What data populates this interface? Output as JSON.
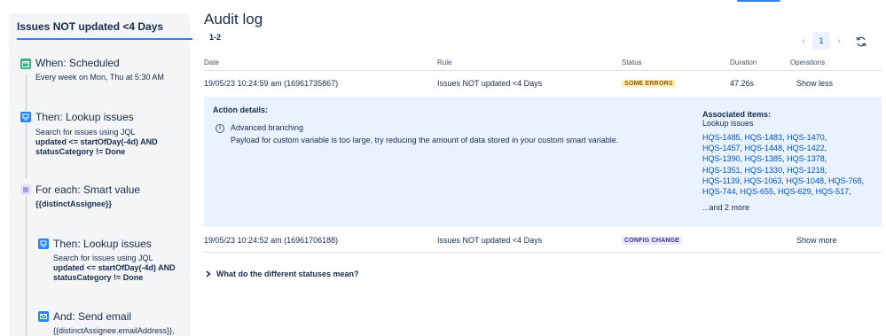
{
  "rule": {
    "title": "Issues NOT updated <4 Days",
    "steps": [
      {
        "heading": "When: Scheduled",
        "lines": [
          "Every week on Mon, Thu at 5:30 AM"
        ]
      },
      {
        "heading": "Then: Lookup issues",
        "lines": [
          "Search for issues using JQL"
        ],
        "bold_lines": [
          "updated <= startOfDay(-4d) AND",
          "statusCategory != Done"
        ]
      },
      {
        "heading": "For each: Smart value",
        "bold_lines": [
          "{{distinctAssignee}}"
        ]
      },
      {
        "heading": "Then: Lookup issues",
        "lines": [
          "Search for issues using JQL"
        ],
        "bold_lines": [
          "updated <= startOfDay(-4d) AND",
          "statusCategory != Done"
        ]
      },
      {
        "heading": "And: Send email",
        "lines": [
          "{{distinctAssignee.emailAddress}},"
        ]
      }
    ]
  },
  "audit": {
    "title": "Audit log",
    "range": "1-2",
    "pagination": {
      "prev": "‹",
      "current": "1",
      "next": "›"
    },
    "columns": {
      "date": "Date",
      "rule": "Rule",
      "status": "Status",
      "duration": "Duration",
      "operations": "Operations"
    },
    "rows": [
      {
        "date": "19/05/23 10:24:59 am (16961735867)",
        "rule": "Issues NOT updated <4 Days",
        "status": "SOME ERRORS",
        "duration": "47.26s",
        "operation": "Show less"
      },
      {
        "date": "19/05/23 10:24:52 am (16961706188)",
        "rule": "Issues NOT updated <4 Days",
        "status": "CONFIG CHANGE",
        "duration": "",
        "operation": "Show more"
      }
    ],
    "details": {
      "title": "Action details:",
      "action_name": "Advanced branching",
      "message": "Payload for custom variable is too large, try reducing the amount of data stored in your custom smart variable.",
      "associated_title": "Associated items:",
      "associated_subtitle": "Lookup issues",
      "issues": [
        "HQS-1485",
        "HQS-1483",
        "HQS-1470",
        "HQS-1457",
        "HQS-1448",
        "HQS-1422",
        "HQS-1390",
        "HQS-1385",
        "HQS-1378",
        "HQS-1351",
        "HQS-1330",
        "HQS-1218",
        "HQS-1139",
        "HQS-1063",
        "HQS-1048",
        "HQS-768",
        "HQS-744",
        "HQS-655",
        "HQS-629",
        "HQS-517"
      ],
      "more": "...and 2 more"
    },
    "faq": "What do the different statuses mean?"
  },
  "colors": {
    "accent": "#2f80ed",
    "link": "#0052cc",
    "details_bg": "#e9f2ff",
    "error_bg": "#fff0b3",
    "config_bg": "#eae6ff"
  }
}
